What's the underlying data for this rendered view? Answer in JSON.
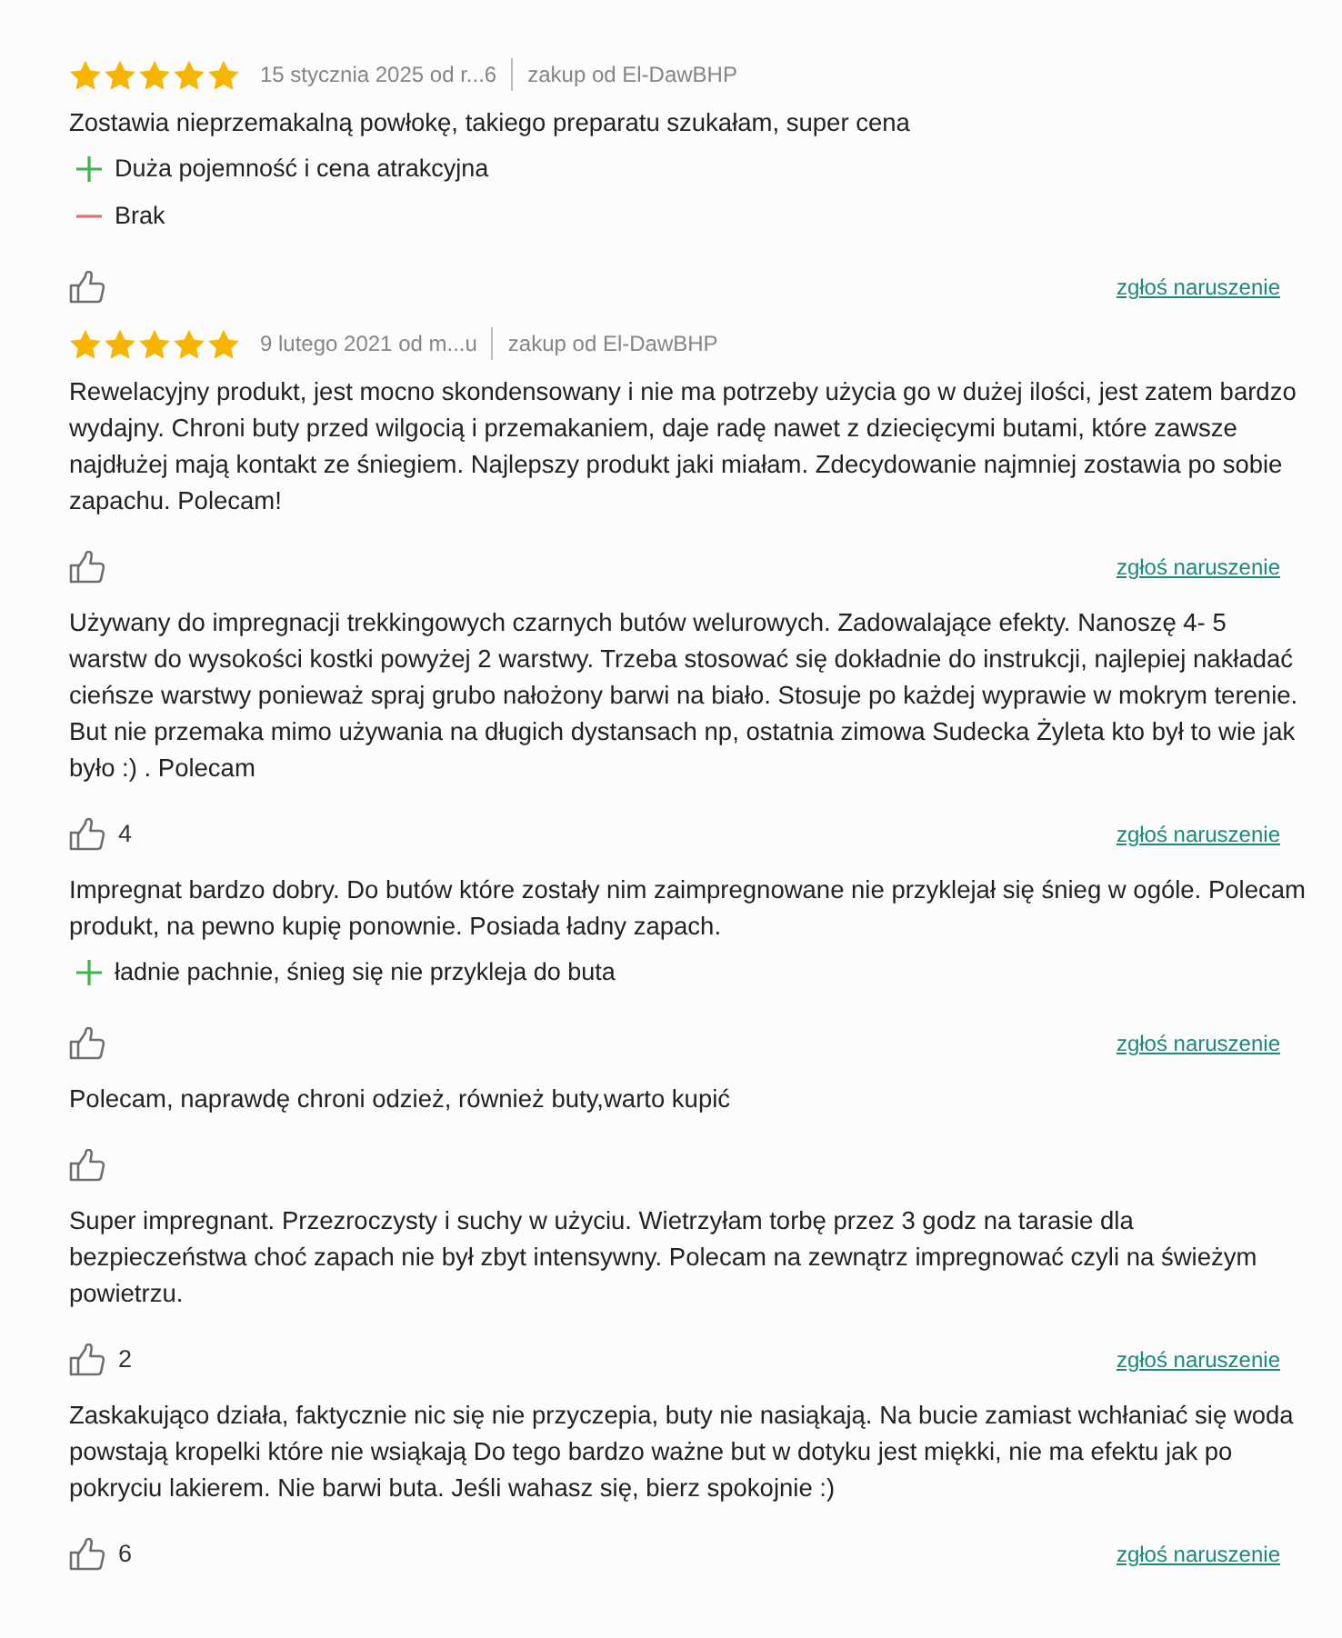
{
  "reviews": [
    {
      "stars": 5,
      "date": "15 stycznia 2025 od r...6",
      "source": "zakup od El-DawBHP",
      "text": "Zostawia nieprzemakalną powłokę, takiego preparatu szukałam, super cena",
      "points": [
        {
          "kind": "pro",
          "text": "Duża pojemność i cena atrakcyjna"
        },
        {
          "kind": "con",
          "text": "Brak"
        }
      ],
      "report": "zgłoś naruszenie"
    },
    {
      "stars": 5,
      "date": "9 lutego 2021 od m...u",
      "source": "zakup od El-DawBHP",
      "text": "Rewelacyjny produkt, jest mocno skondensowany i nie ma potrzeby użycia go w dużej ilości, jest zatem bardzo wydajny. Chroni buty przed wilgocią i przemakaniem, daje radę nawet z dziecięcymi butami, które zawsze najdłużej mają kontakt ze śniegiem. Najlepszy produkt jaki miałam. Zdecydowanie najmniej zostawia po sobie zapachu. Polecam!",
      "report": "zgłoś naruszenie"
    },
    {
      "text": "Używany do impregnacji trekkingowych czarnych butów welurowych. Zadowalające efekty. Nanoszę 4- 5 warstw do wysokości kostki powyżej 2 warstwy. Trzeba stosować się dokładnie do instrukcji, najlepiej nakładać cieńsze warstwy ponieważ spraj grubo nałożony barwi na biało. Stosuje po każdej wyprawie w mokrym terenie. But nie przemaka mimo używania na długich dystansach np, ostatnia zimowa Sudecka Żyleta kto był to wie jak było :) . Polecam",
      "likes": "4",
      "report": "zgłoś naruszenie"
    },
    {
      "text": "Impregnat bardzo dobry. Do butów które zostały nim zaimpregnowane nie przyklejał się śnieg w ogóle. Polecam produkt, na pewno kupię ponownie. Posiada ładny zapach.",
      "points": [
        {
          "kind": "pro",
          "text": "ładnie pachnie, śnieg się nie przykleja do buta"
        }
      ],
      "report": "zgłoś naruszenie"
    },
    {
      "text": "Polecam, naprawdę chroni odzież, również buty,warto kupić"
    },
    {
      "text": "Super impregnant. Przezroczysty i suchy w użyciu. Wietrzyłam torbę przez 3 godz na tarasie dla bezpieczeństwa choć zapach nie był zbyt intensywny. Polecam na zewnątrz impregnować czyli na świeżym powietrzu.",
      "likes": "2",
      "report": "zgłoś naruszenie"
    },
    {
      "text": "Zaskakująco działa, faktycznie nic się nie przyczepia, buty nie nasiąkają. Na bucie zamiast wchłaniać się woda powstają kropelki które nie wsiąkają Do tego bardzo ważne but w dotyku jest miękki, nie ma efektu jak po pokryciu lakierem. Nie barwi buta. Jeśli wahasz się, bierz spokojnie :)",
      "likes": "6",
      "report": "zgłoś naruszenie"
    }
  ]
}
